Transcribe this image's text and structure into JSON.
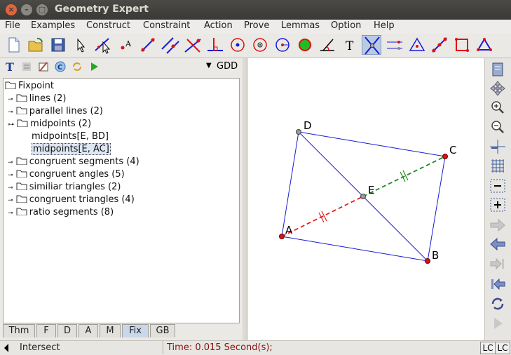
{
  "window": {
    "title": "Geometry Expert"
  },
  "menu": [
    "File",
    "Examples",
    "Construct",
    "Constraint",
    "Action",
    "Prove",
    "Lemmas",
    "Option",
    "Help"
  ],
  "toolbar_icons": [
    "new-file-icon",
    "open-folder-icon",
    "save-icon",
    "select-pointer-icon",
    "drag-pointer-icon",
    "text-point-icon",
    "line-icon",
    "parallel-line-icon",
    "perpendicular-cross-icon",
    "perpendicular-foot-icon",
    "circle-center-icon",
    "circle-three-point-icon",
    "circle-radius-icon",
    "polygon-icon",
    "angle-icon",
    "text-tool-icon",
    "intersect-icon",
    "mirror-icon",
    "triangle-icon",
    "midpoint-icon",
    "square-icon",
    "triangle-red-icon"
  ],
  "left_toolbar": {
    "mode_label": "GDD"
  },
  "tree": {
    "root": "Fixpoint",
    "items": [
      {
        "label": "lines (2)",
        "level": 1,
        "expanded": false
      },
      {
        "label": "parallel lines (2)",
        "level": 1,
        "expanded": false
      },
      {
        "label": "midpoints (2)",
        "level": 1,
        "expanded": true
      },
      {
        "label": "midpoints[E, BD]",
        "level": 2,
        "selected": false
      },
      {
        "label": "midpoints[E, AC]",
        "level": 2,
        "selected": true
      },
      {
        "label": "congruent segments (4)",
        "level": 1,
        "expanded": false
      },
      {
        "label": "congruent angles (5)",
        "level": 1,
        "expanded": false
      },
      {
        "label": "similiar triangles (2)",
        "level": 1,
        "expanded": false
      },
      {
        "label": "congruent triangles (4)",
        "level": 1,
        "expanded": false
      },
      {
        "label": "ratio segments (8)",
        "level": 1,
        "expanded": false
      }
    ]
  },
  "tabs": [
    {
      "label": "Thm",
      "active": false
    },
    {
      "label": "F",
      "active": false
    },
    {
      "label": "D",
      "active": false
    },
    {
      "label": "A",
      "active": false
    },
    {
      "label": "M",
      "active": false
    },
    {
      "label": "Fix",
      "active": true
    },
    {
      "label": "GB",
      "active": false
    }
  ],
  "figure": {
    "points": [
      {
        "name": "A",
        "color": "#d11"
      },
      {
        "name": "B",
        "color": "#d11"
      },
      {
        "name": "C",
        "color": "#d11"
      },
      {
        "name": "D",
        "color": "#999"
      },
      {
        "name": "E",
        "color": "#999"
      }
    ],
    "colors": {
      "polygon": "#1a1ad6",
      "ae_dash": "#e02020",
      "ec_dash": "#1f8a1f"
    }
  },
  "right_toolbar_icons": [
    "theorem-book-icon",
    "move-icon",
    "zoom-in-icon",
    "zoom-out-icon",
    "crosshair-icon",
    "grid-icon",
    "grid-minus-icon",
    "grid-plus-icon",
    "forward-arrow-icon",
    "back-arrow-icon",
    "step-forward-icon",
    "step-back-icon",
    "refresh-icon",
    "play-icon"
  ],
  "status": {
    "mode": "Intersect",
    "time": "Time: 0.015 Second(s);",
    "btn1": "LC",
    "btn2": "LC"
  }
}
